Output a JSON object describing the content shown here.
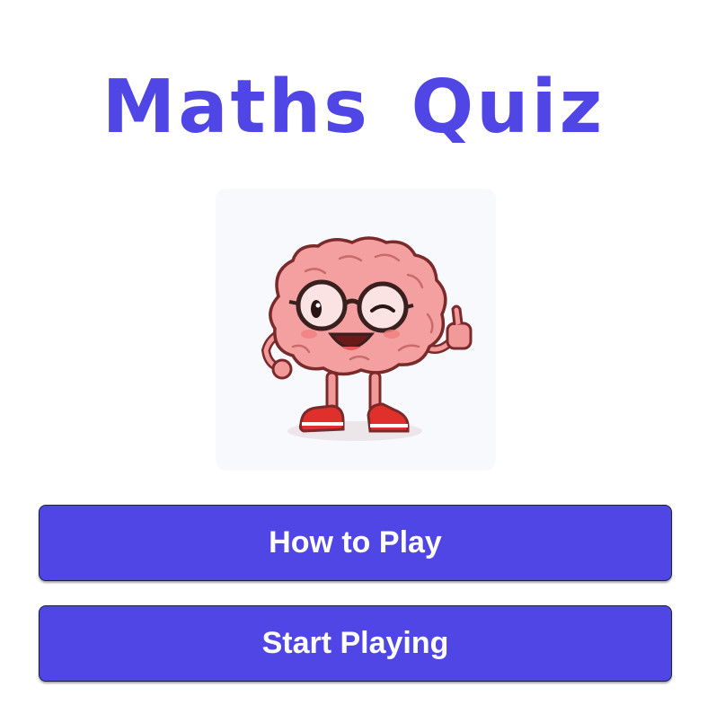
{
  "title": "Maths Quiz",
  "mascot": {
    "icon": "brain-mascot-icon",
    "description_colors": {
      "brain": "#f4a0a0",
      "outline": "#7a2a2a",
      "shoes": "#e0302b",
      "glasses": "#3a1f1f"
    }
  },
  "buttons": {
    "how_to_play": "How to Play",
    "start_playing": "Start Playing"
  },
  "colors": {
    "accent": "#4f46e5",
    "background": "#ffffff",
    "card_background": "#f8f9fc",
    "button_text": "#ffffff"
  }
}
